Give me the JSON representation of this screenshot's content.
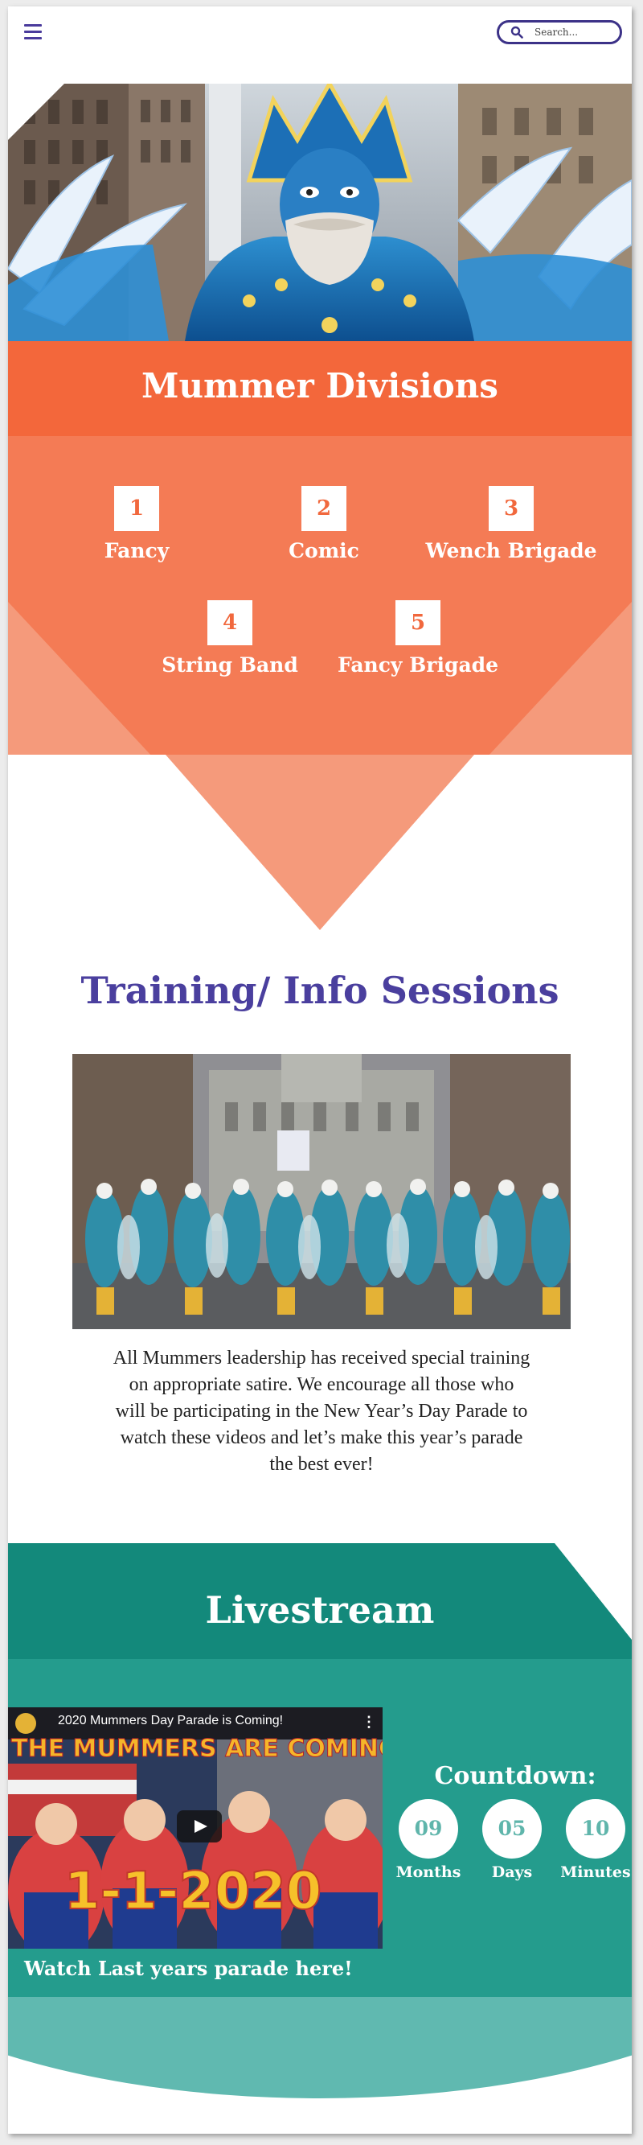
{
  "header": {
    "search_placeholder": "Search..."
  },
  "divisions": {
    "title": "Mummer Divisions",
    "items": [
      {
        "number": "1",
        "label": "Fancy"
      },
      {
        "number": "2",
        "label": "Comic"
      },
      {
        "number": "3",
        "label": "Wench Brigade"
      },
      {
        "number": "4",
        "label": "String Band"
      },
      {
        "number": "5",
        "label": "Fancy Brigade"
      }
    ]
  },
  "training": {
    "title": "Training/ Info Sessions",
    "text": "All Mummers leadership has received special training on appropriate satire. We encourage all those who will be participating in the New Year’s Day Parade to watch these videos and let’s make this year’s parade the best ever!"
  },
  "livestream": {
    "title": "Livestream",
    "video": {
      "title": "2020 Mummers Day Parade is Coming!",
      "banner": "THE MUMMERS ARE COMING!",
      "date": "1-1-2020",
      "menu_glyph": "⋮"
    },
    "watch_label": "Watch Last years parade here!",
    "countdown": {
      "title": "Countdown:",
      "items": [
        {
          "value": "09",
          "label": "Months"
        },
        {
          "value": "05",
          "label": "Days"
        },
        {
          "value": "10",
          "label": "Minutes"
        }
      ]
    }
  },
  "colors": {
    "accent_purple": "#4a3f9e",
    "orange": "#f3673b",
    "teal_dark": "#13897b",
    "teal": "#249c8d",
    "teal_light": "#60b9b0"
  }
}
